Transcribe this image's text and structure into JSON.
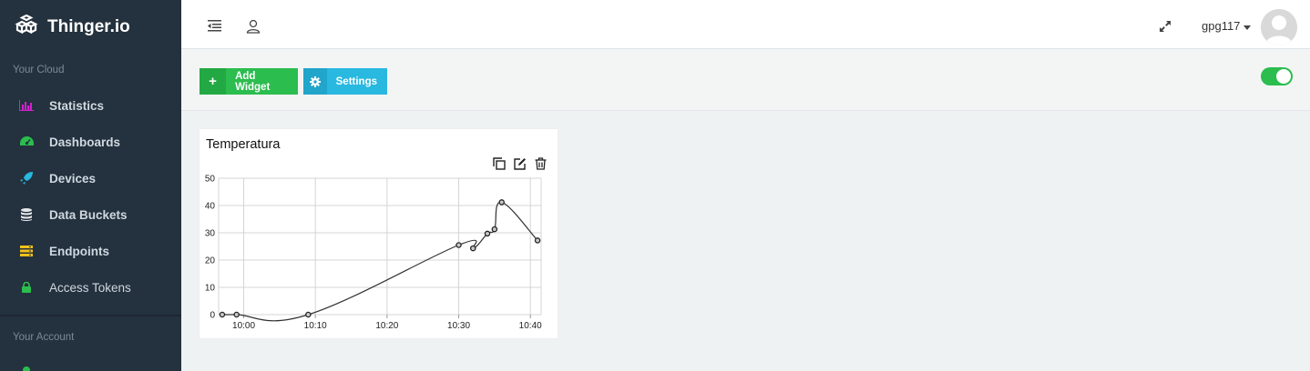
{
  "brand": {
    "name": "Thinger.io"
  },
  "sidebar": {
    "cloud_label": "Your Cloud",
    "account_label": "Your Account",
    "items": [
      {
        "label": "Statistics",
        "icon": "bar-chart-icon",
        "color": "#d61fd3"
      },
      {
        "label": "Dashboards",
        "icon": "dashboard-icon",
        "color": "#2bbd4e"
      },
      {
        "label": "Devices",
        "icon": "rocket-icon",
        "color": "#28b8e0"
      },
      {
        "label": "Data Buckets",
        "icon": "database-icon",
        "color": "#e5e8ea"
      },
      {
        "label": "Endpoints",
        "icon": "server-icon",
        "color": "#f2c21b"
      },
      {
        "label": "Access Tokens",
        "icon": "lock-icon",
        "color": "#2bbd4e"
      }
    ]
  },
  "topbar": {
    "username": "gpg117"
  },
  "toolbar": {
    "add_widget": "Add Widget",
    "settings": "Settings",
    "edit_mode_on": true
  },
  "widget": {
    "title": "Temperatura",
    "chart_data": {
      "type": "line",
      "y_ticks": [
        "0",
        "10",
        "20",
        "30",
        "40",
        "50"
      ],
      "x_ticks": [
        "10:00",
        "10:10",
        "10:20",
        "10:30",
        "10:40"
      ],
      "ylim": [
        0,
        50
      ],
      "grid": true,
      "series": [
        {
          "color": "#333333",
          "x": [
            "09:57",
            "09:59",
            "10:09",
            "10:30",
            "10:32",
            "10:34",
            "10:35",
            "10:36",
            "10:41"
          ],
          "values": [
            0,
            0,
            0,
            25.5,
            24.3,
            29.7,
            31.3,
            41.2,
            27.2
          ]
        }
      ]
    }
  }
}
